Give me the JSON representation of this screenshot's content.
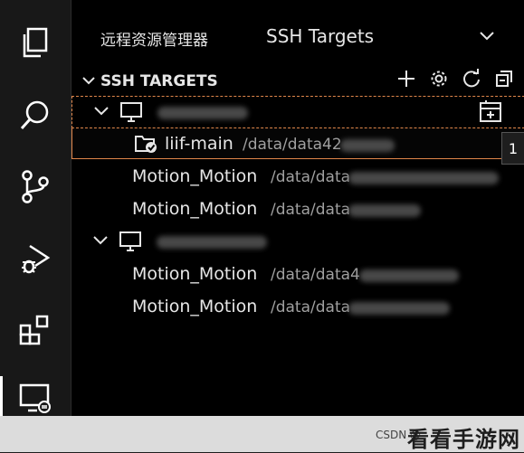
{
  "activity_bar": {
    "items": [
      {
        "icon": "explorer-icon"
      },
      {
        "icon": "search-icon"
      },
      {
        "icon": "source-control-icon"
      },
      {
        "icon": "run-debug-icon"
      },
      {
        "icon": "extensions-icon"
      },
      {
        "icon": "remote-explorer-icon"
      }
    ]
  },
  "sidebar": {
    "title": "远程资源管理器",
    "view_select": "SSH Targets",
    "section_title": "SSH TARGETS",
    "actions": [
      "add-icon",
      "gear-icon",
      "refresh-icon",
      "collapse-all-icon"
    ]
  },
  "tree": {
    "host1": {
      "name": ""
    },
    "host1_folders": [
      {
        "label": "liif-main",
        "path": "/data/data42"
      },
      {
        "label": "Motion_Motion",
        "path": "/data/data"
      },
      {
        "label": "Motion_Motion",
        "path": "/data/data"
      }
    ],
    "host2": {
      "name": ""
    },
    "host2_folders": [
      {
        "label": "Motion_Motion",
        "path": "/data/data4"
      },
      {
        "label": "Motion_Motion",
        "path": "/data/data"
      }
    ]
  },
  "badge": "1",
  "watermark": {
    "csdn": "CSDN @",
    "site": "看看手游网"
  },
  "colors": {
    "highlight": "#e0864a",
    "background": "#000000"
  }
}
